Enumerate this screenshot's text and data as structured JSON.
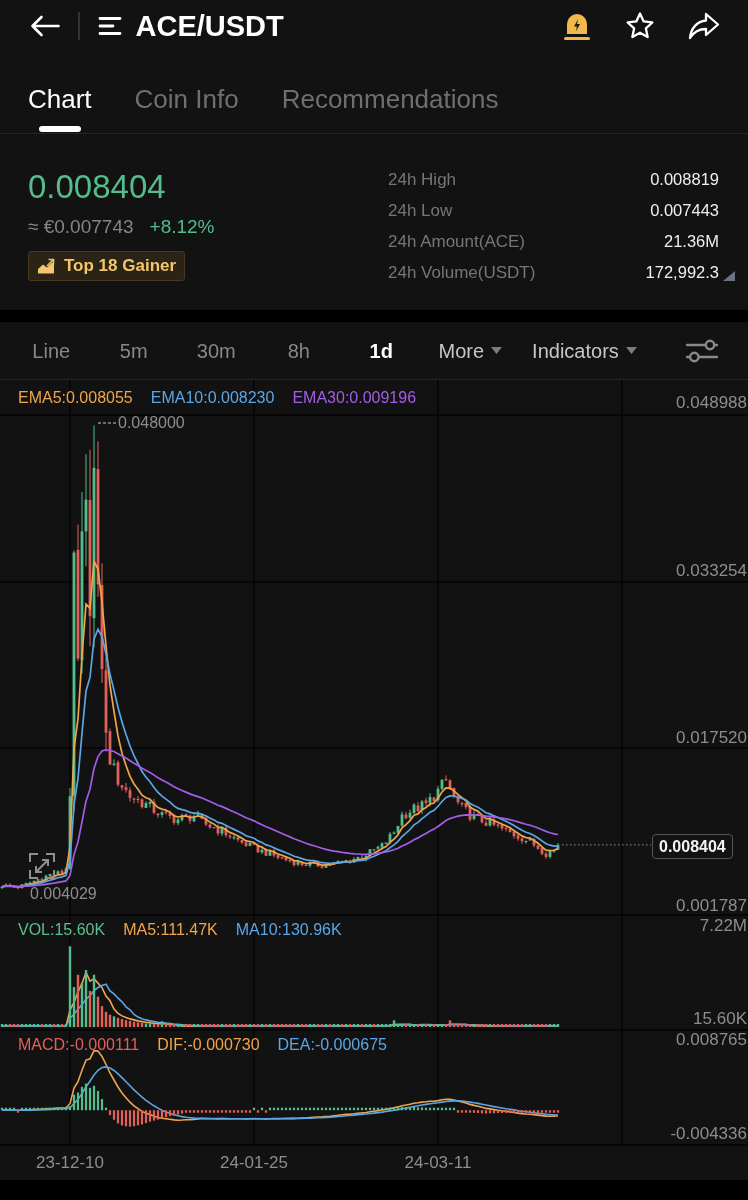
{
  "header": {
    "title": "ACE/USDT"
  },
  "tabs": [
    {
      "label": "Chart",
      "selected": true
    },
    {
      "label": "Coin Info",
      "selected": false
    },
    {
      "label": "Recommendations",
      "selected": false
    }
  ],
  "ticker": {
    "price": "0.008404",
    "fiat_price": "≈ €0.007743",
    "change": "+8.12%",
    "badge": "Top 18 Gainer"
  },
  "stats": [
    {
      "label": "24h High",
      "value": "0.008819"
    },
    {
      "label": "24h Low",
      "value": "0.007443"
    },
    {
      "label": "24h Amount(ACE)",
      "value": "21.36M"
    },
    {
      "label": "24h Volume(USDT)",
      "value": "172,992.3"
    }
  ],
  "toolbar": {
    "intervals": [
      {
        "label": "Line",
        "selected": false
      },
      {
        "label": "5m",
        "selected": false
      },
      {
        "label": "30m",
        "selected": false
      },
      {
        "label": "8h",
        "selected": false
      },
      {
        "label": "1d",
        "selected": true
      }
    ],
    "menus": [
      {
        "label": "More"
      },
      {
        "label": "Indicators"
      }
    ]
  },
  "chart": {
    "legend": [
      {
        "label": "EMA5:0.008055",
        "color": "#f0a54a"
      },
      {
        "label": "EMA10:0.008230",
        "color": "#5aa6e6"
      },
      {
        "label": "EMA30:0.009196",
        "color": "#a35de8"
      }
    ],
    "y_axis": [
      "0.048988",
      "0.033254",
      "0.017520",
      "0.001787"
    ],
    "high_marker": "0.048000",
    "low_marker": "0.004029",
    "last_price": "0.008404"
  },
  "volume": {
    "legend": [
      {
        "label": "VOL:15.60K",
        "color": "#5bbf8f"
      },
      {
        "label": "MA5:111.47K",
        "color": "#f0a54a"
      },
      {
        "label": "MA10:130.96K",
        "color": "#5aa6e6"
      }
    ],
    "y_axis": [
      "7.22M",
      "15.60K"
    ]
  },
  "macd": {
    "legend": [
      {
        "label": "MACD:-0.000111",
        "color": "#e0605a"
      },
      {
        "label": "DIF:-0.000730",
        "color": "#f0a54a"
      },
      {
        "label": "DEA:-0.000675",
        "color": "#5aa6e6"
      }
    ],
    "y_axis": [
      "0.008765",
      "-0.004336"
    ]
  },
  "x_axis": [
    "23-12-10",
    "24-01-25",
    "24-03-11"
  ]
}
